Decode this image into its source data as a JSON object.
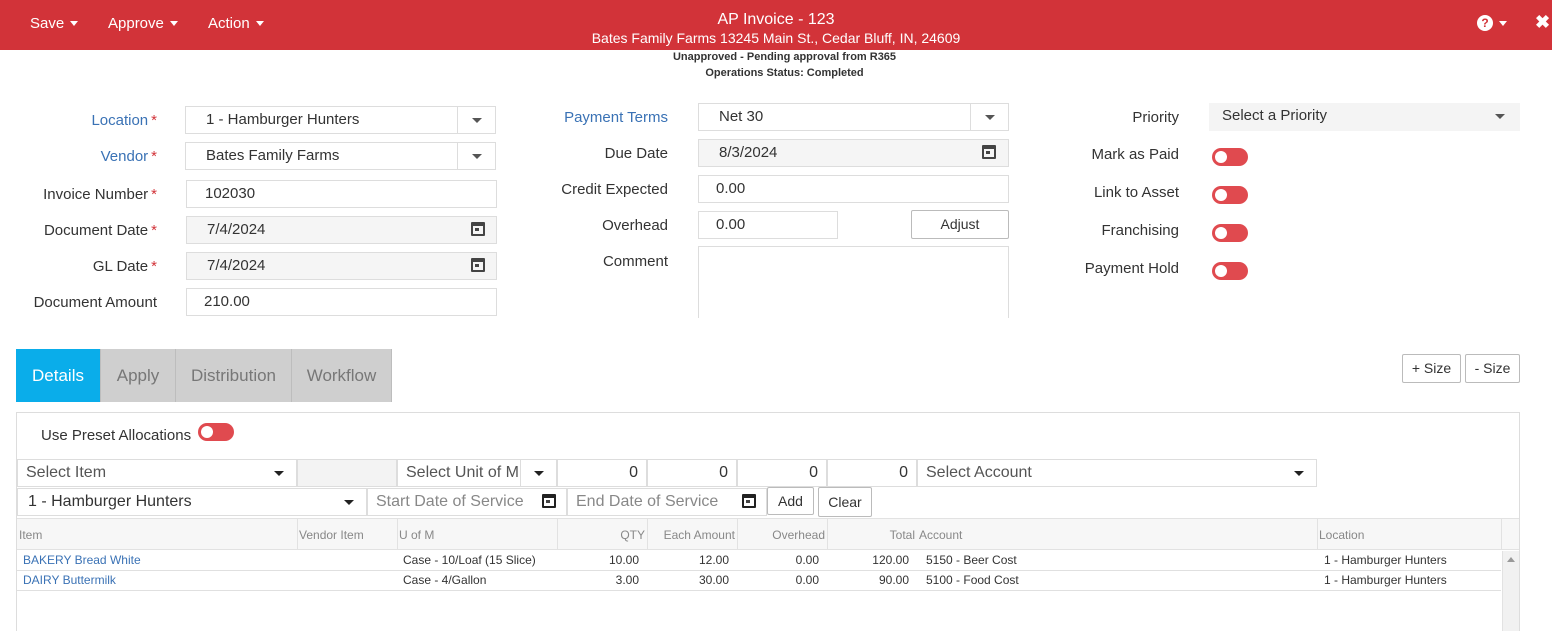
{
  "header": {
    "menu": [
      "Save",
      "Approve",
      "Action"
    ],
    "title": "AP Invoice - 123",
    "subtitle": "Bates Family Farms 13245 Main St., Cedar Bluff, IN, 24609",
    "help_icon": "question-circle-icon",
    "close_icon": "close-icon"
  },
  "status": {
    "line1": "Unapproved - Pending approval from R365",
    "line2": "Operations Status: Completed"
  },
  "form": {
    "location_label": "Location",
    "location_value": "1 - Hamburger Hunters",
    "vendor_label": "Vendor",
    "vendor_value": "Bates Family Farms",
    "invoice_number_label": "Invoice Number",
    "invoice_number_value": "102030",
    "document_date_label": "Document Date",
    "document_date_value": "7/4/2024",
    "gl_date_label": "GL Date",
    "gl_date_value": "7/4/2024",
    "document_amount_label": "Document Amount",
    "document_amount_value": "210.00",
    "required_mark": "*",
    "payment_terms_label": "Payment Terms",
    "payment_terms_value": "Net 30",
    "due_date_label": "Due Date",
    "due_date_value": "8/3/2024",
    "credit_expected_label": "Credit Expected",
    "credit_expected_value": "0.00",
    "overhead_label": "Overhead",
    "overhead_value": "0.00",
    "adjust_label": "Adjust",
    "comment_label": "Comment",
    "comment_value": "",
    "priority_label": "Priority",
    "priority_value": "Select a Priority",
    "mark_as_paid_label": "Mark as Paid",
    "link_to_asset_label": "Link to Asset",
    "franchising_label": "Franchising",
    "payment_hold_label": "Payment Hold",
    "toggles": {
      "mark_as_paid": false,
      "link_to_asset": false,
      "franchising": false,
      "payment_hold": false
    }
  },
  "tabs": [
    "Details",
    "Apply",
    "Distribution",
    "Workflow"
  ],
  "active_tab": "Details",
  "size_buttons": {
    "plus": "+ Size",
    "minus": "- Size"
  },
  "details": {
    "preset_label": "Use Preset Allocations",
    "select_item": "Select Item",
    "select_uom": "Select Unit of M",
    "qty": "0",
    "each_amount": "0",
    "overhead": "0",
    "total": "0",
    "select_account": "Select Account",
    "location_value": "1 - Hamburger Hunters",
    "start_date": "Start Date of Service",
    "end_date": "End Date of Service",
    "add_label": "Add",
    "clear_label": "Clear"
  },
  "table": {
    "columns": [
      "Item",
      "Vendor Item",
      "U of M",
      "QTY",
      "Each Amount",
      "Overhead",
      "Total",
      "Account",
      "Location"
    ],
    "rows": [
      {
        "item": "BAKERY Bread White",
        "vendor_item": "",
        "uom": "Case - 10/Loaf (15 Slice)",
        "qty": "10.00",
        "each": "12.00",
        "overhead": "0.00",
        "total": "120.00",
        "account": "5150 - Beer Cost",
        "location": "1 - Hamburger Hunters"
      },
      {
        "item": "DAIRY Buttermilk",
        "vendor_item": "",
        "uom": "Case - 4/Gallon",
        "qty": "3.00",
        "each": "30.00",
        "overhead": "0.00",
        "total": "90.00",
        "account": "5100 - Food Cost",
        "location": "1 - Hamburger Hunters"
      }
    ]
  },
  "colors": {
    "brand": "#d23339",
    "active_tab": "#0aadea",
    "link": "#3a72b5",
    "toggle_off": "#e04a4f"
  }
}
